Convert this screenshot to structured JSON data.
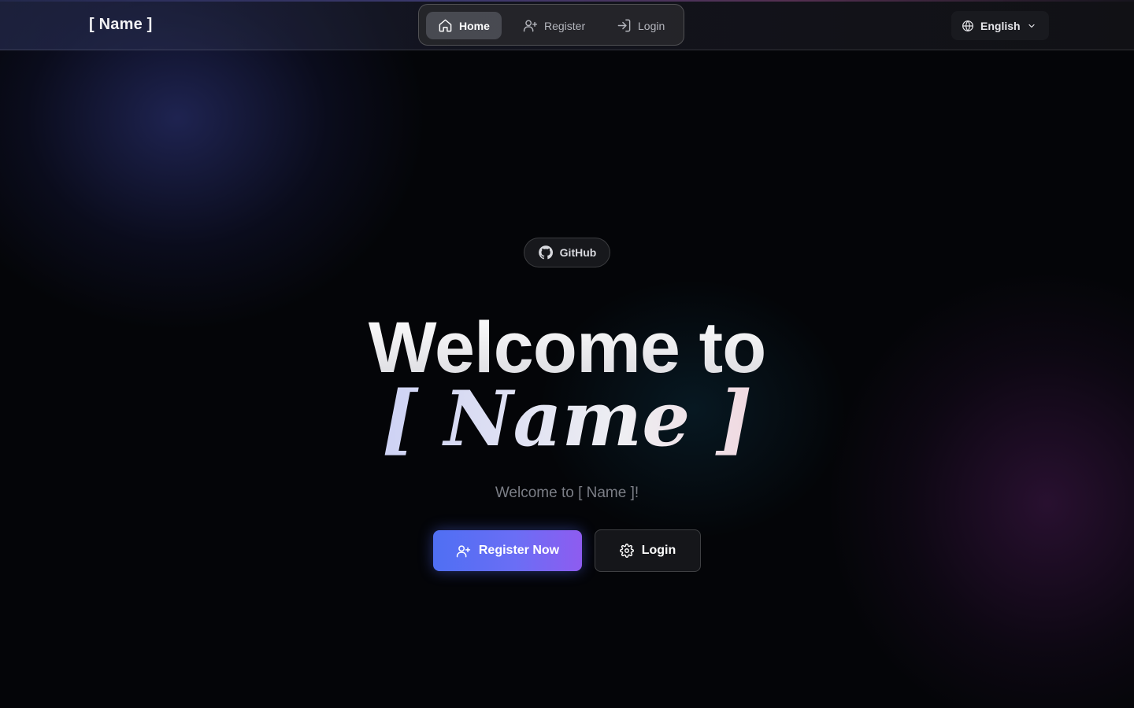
{
  "header": {
    "brand": "[ Name ]",
    "nav": [
      {
        "label": "Home",
        "icon": "home-icon",
        "active": true
      },
      {
        "label": "Register",
        "icon": "user-plus-icon",
        "active": false
      },
      {
        "label": "Login",
        "icon": "log-in-icon",
        "active": false
      }
    ],
    "language": {
      "label": "English",
      "icon": "globe-icon"
    }
  },
  "hero": {
    "github_label": "GitHub",
    "title": "Welcome to",
    "name": "[ Name ]",
    "subtitle": "Welcome to [ Name ]!",
    "primary_button": {
      "label": "Register Now",
      "icon": "user-plus-icon"
    },
    "secondary_button": {
      "label": "Login",
      "icon": "gear-icon"
    }
  },
  "colors": {
    "background": "#040508",
    "primary_gradient_start": "#4f6ff3",
    "primary_gradient_end": "#8e5cf0",
    "name_gradient_start": "#8f9cf5",
    "name_gradient_end": "#f59aa8"
  }
}
